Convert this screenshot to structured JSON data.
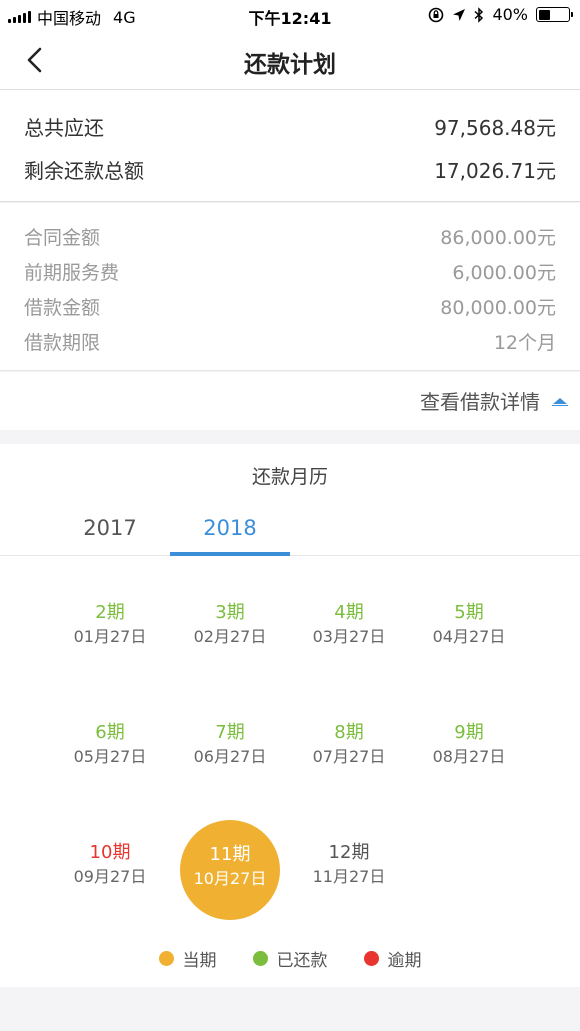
{
  "status_bar": {
    "carrier": "中国移动",
    "network": "4G",
    "time": "下午12:41",
    "battery_label": "40%",
    "battery_level": 0.4
  },
  "nav": {
    "title": "还款计划"
  },
  "summary": {
    "total_due_label": "总共应还",
    "total_due_value": "97,568.48元",
    "remaining_label": "剩余还款总额",
    "remaining_value": "17,026.71元"
  },
  "details": [
    {
      "label": "合同金额",
      "value": "86,000.00元"
    },
    {
      "label": "前期服务费",
      "value": "6,000.00元"
    },
    {
      "label": "借款金额",
      "value": "80,000.00元"
    },
    {
      "label": "借款期限",
      "value": "12个月"
    }
  ],
  "toggle": {
    "label": "查看借款详情"
  },
  "calendar": {
    "title": "还款月历",
    "years": [
      "2017",
      "2018"
    ],
    "active_year": "2018",
    "periods": [
      {
        "period": "2期",
        "date": "01月27日",
        "status": "paid"
      },
      {
        "period": "3期",
        "date": "02月27日",
        "status": "paid"
      },
      {
        "period": "4期",
        "date": "03月27日",
        "status": "paid"
      },
      {
        "period": "5期",
        "date": "04月27日",
        "status": "paid"
      },
      {
        "period": "6期",
        "date": "05月27日",
        "status": "paid"
      },
      {
        "period": "7期",
        "date": "06月27日",
        "status": "paid"
      },
      {
        "period": "8期",
        "date": "07月27日",
        "status": "paid"
      },
      {
        "period": "9期",
        "date": "08月27日",
        "status": "paid"
      },
      {
        "period": "10期",
        "date": "09月27日",
        "status": "overdue"
      },
      {
        "period": "11期",
        "date": "10月27日",
        "status": "current"
      },
      {
        "period": "12期",
        "date": "11月27日",
        "status": "future"
      }
    ],
    "legend": [
      {
        "label": "当期",
        "color": "#f0b133"
      },
      {
        "label": "已还款",
        "color": "#7bbd3c"
      },
      {
        "label": "逾期",
        "color": "#e8352f"
      }
    ]
  }
}
